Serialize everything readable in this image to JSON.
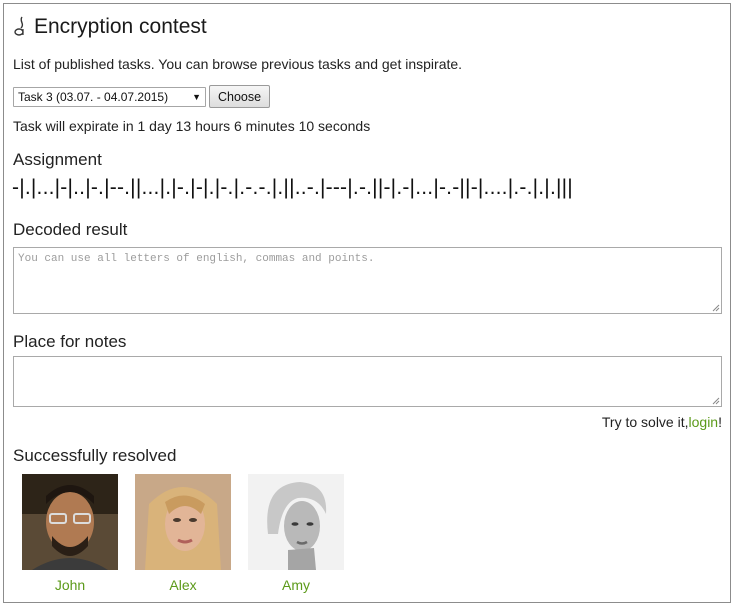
{
  "header": {
    "title": "Encryption contest",
    "icon": "music-note-icon"
  },
  "intro": "List of published tasks. You can browse previous tasks and get inspirate.",
  "task_select": {
    "value": "Task 3 (03.07. - 04.07.2015)"
  },
  "choose_label": "Choose",
  "expiration": "Task will expirate in 1 day 13 hours 6 minutes 10 seconds",
  "assignment": {
    "heading": "Assignment",
    "cipher": "-|.|...|-|..|-.|--.||...|.|-.|-|.|-.|.-.-.|.||..-.|---|.-.||-|.-|...|-.-||-|....|.-.|.|.|||"
  },
  "decoded": {
    "heading": "Decoded result",
    "placeholder": "You can use all letters of english, commas and points."
  },
  "notes": {
    "heading": "Place for notes"
  },
  "login_prompt": {
    "text": "Try to solve it,",
    "link": "login",
    "suffix": "!"
  },
  "resolved": {
    "heading": "Successfully resolved",
    "users": [
      {
        "name": "John"
      },
      {
        "name": "Alex"
      },
      {
        "name": "Amy"
      }
    ]
  },
  "colors": {
    "link": "#5c9a1a",
    "border": "#8c8c8c"
  }
}
